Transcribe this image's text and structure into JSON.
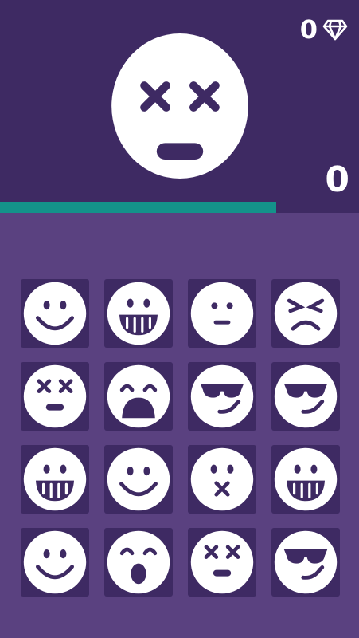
{
  "colors": {
    "header_bg": "#3e2a63",
    "board_bg": "#5a4180",
    "tile_bg": "#3e2a63",
    "accent": "#14928a",
    "face": "#ffffff"
  },
  "gems": {
    "count": "0",
    "icon": "diamond-icon"
  },
  "score": "0",
  "target_face": "dizzy",
  "progress": 0.77,
  "grid": [
    "smile",
    "grin",
    "neutral",
    "angry",
    "dizzy",
    "frightened",
    "cool",
    "cool",
    "grin",
    "smile",
    "kiss",
    "grin",
    "smile",
    "shocked",
    "dizzy",
    "cool"
  ]
}
